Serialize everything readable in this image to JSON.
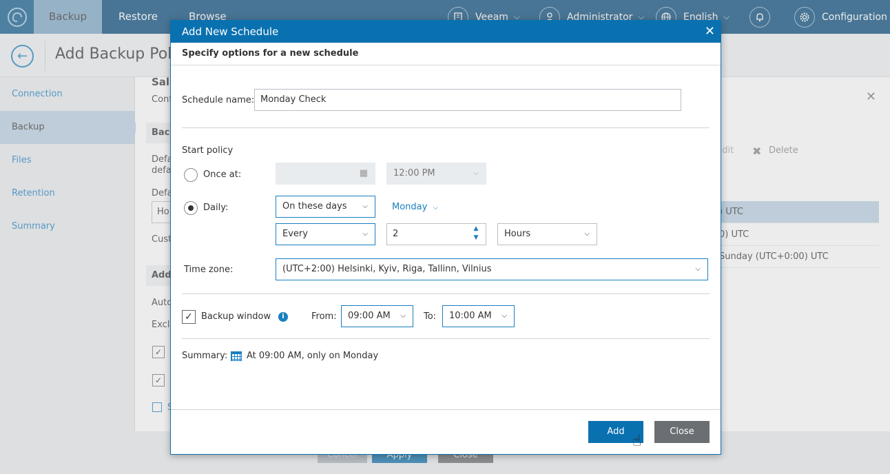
{
  "topbar": {
    "tabs": [
      "Backup",
      "Restore",
      "Browse"
    ],
    "org": "Veeam",
    "user": "Administrator",
    "language": "English",
    "configuration": "Configuration"
  },
  "page": {
    "title": "Add Backup Policy"
  },
  "sidebar": {
    "items": [
      "Connection",
      "Backup",
      "Files",
      "Retention",
      "Summary"
    ],
    "active": "Backup"
  },
  "background": {
    "sale": "Sale",
    "conf": "Conf",
    "back": "Back",
    "defa1": "Defa",
    "defa2": "defa",
    "defa3": "Defa",
    "ho": "Ho",
    "cust": "Cust",
    "addi": "Addi",
    "auto": "Auto",
    "exclu": "Exclu",
    "s": "S",
    "cancel_btn": "Cancel",
    "apply_btn": "Apply",
    "close_btn": "Close"
  },
  "right_panel": {
    "edit": "Edit",
    "delete": "Delete",
    "rows": [
      ") UTC",
      "0) UTC",
      "Sunday (UTC+0:00) UTC"
    ]
  },
  "dialog": {
    "title": "Add New Schedule",
    "subtitle": "Specify options for a new schedule",
    "schedule_name_label": "Schedule name:",
    "schedule_name_value": "Monday Check",
    "start_policy_label": "Start policy",
    "once_at_label": "Once at:",
    "once_at_time": "12:00 PM",
    "daily_label": "Daily:",
    "daily_mode": "On these days",
    "daily_days": "Monday",
    "every_label": "Every",
    "every_value": "2",
    "every_unit": "Hours",
    "time_zone_label": "Time zone:",
    "time_zone_value": "(UTC+2:00) Helsinki, Kyiv, Riga, Tallinn, Vilnius",
    "backup_window_label": "Backup window",
    "from_label": "From:",
    "from_value": "09:00 AM",
    "to_label": "To:",
    "to_value": "10:00 AM",
    "summary_label": "Summary:",
    "summary_value": "At 09:00 AM, only on Monday",
    "add_button": "Add",
    "close_button": "Close"
  },
  "colors": {
    "topbar": "#04497a",
    "accent": "#0a71b0",
    "link": "#1a7fc1",
    "active_tab": "#7ba7c6"
  }
}
